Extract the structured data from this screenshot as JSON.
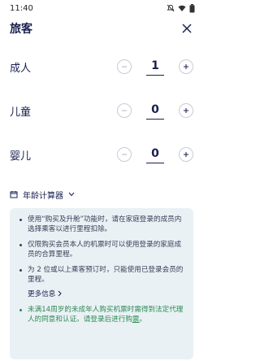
{
  "status_bar": {
    "time": "11:40"
  },
  "header": {
    "title": "旅客"
  },
  "passengers": [
    {
      "label": "成人",
      "count": "1"
    },
    {
      "label": "儿童",
      "count": "0"
    },
    {
      "label": "婴儿",
      "count": "0"
    }
  ],
  "age_calculator": {
    "label": "年龄计算器"
  },
  "notice": {
    "items": [
      "使用“购买及升舱”功能时，请在家庭登录的成员内选择乘客以进行里程扣除。",
      "仅限购买会员本人的机票时可以使用登录的家庭成员的合算里程。",
      "为 2 位或以上乘客预订时，只能使用已登录会员的里程。"
    ],
    "more_info": "更多信息",
    "minor_notice_text": "未满14周岁的未成年人购买机票时需得到法定代理人的同意和认证。请登录后进行购",
    "minor_notice_link": "票",
    "minor_notice_end": "。"
  }
}
